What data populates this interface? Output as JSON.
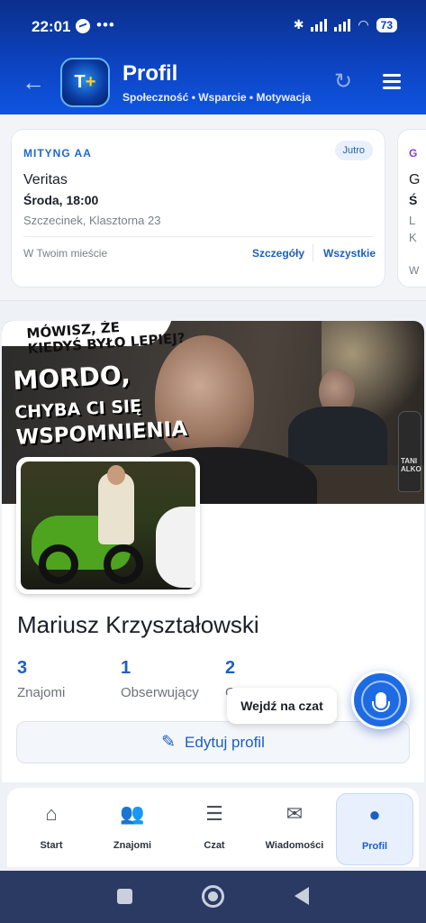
{
  "status_bar": {
    "time": "22:01",
    "dots": "•••",
    "battery": "73"
  },
  "header": {
    "title": "Profil",
    "subtitle": "Społeczność • Wsparcie • Motywacja",
    "logo_text": "T",
    "logo_plus": "+",
    "back_icon": "←",
    "refresh_icon": "↻"
  },
  "meeting_card": {
    "label": "MITYNG AA",
    "badge": "Jutro",
    "name": "Veritas",
    "when": "Środa, 18:00",
    "address": "Szczecinek, Klasztorna 23",
    "city_note": "W Twoim mieście",
    "details_link": "Szczegóły",
    "all_link": "Wszystkie"
  },
  "meeting_card_peek": {
    "label": "G",
    "line1": "G",
    "line2": "Ś",
    "line3": "L",
    "line4": "K",
    "line5": "W"
  },
  "cover": {
    "bubble_text": "MÓWISZ, ŻE\nKIEDYŚ BYŁO LEPIEJ?",
    "title_line1": "MORDO,",
    "title_line2": "CHYBA CI SIĘ",
    "title_line3": "WSPOMNIENIA",
    "bottle_text": "TANI ALKO"
  },
  "profile": {
    "name": "Mariusz Krzyształowski",
    "stats": [
      {
        "value": "3",
        "label": "Znajomi"
      },
      {
        "value": "1",
        "label": "Obserwujący"
      },
      {
        "value": "2",
        "label": "O"
      }
    ],
    "edit_label": "Edytuj profil",
    "edit_icon": "✎"
  },
  "chat": {
    "tooltip": "Wejdź na czat"
  },
  "bottom_nav": [
    {
      "label": "Start",
      "icon": "⌂"
    },
    {
      "label": "Znajomi",
      "icon": "👥"
    },
    {
      "label": "Czat",
      "icon": "☰"
    },
    {
      "label": "Wiadomości",
      "icon": "✉"
    },
    {
      "label": "Profil",
      "icon": "●"
    }
  ]
}
